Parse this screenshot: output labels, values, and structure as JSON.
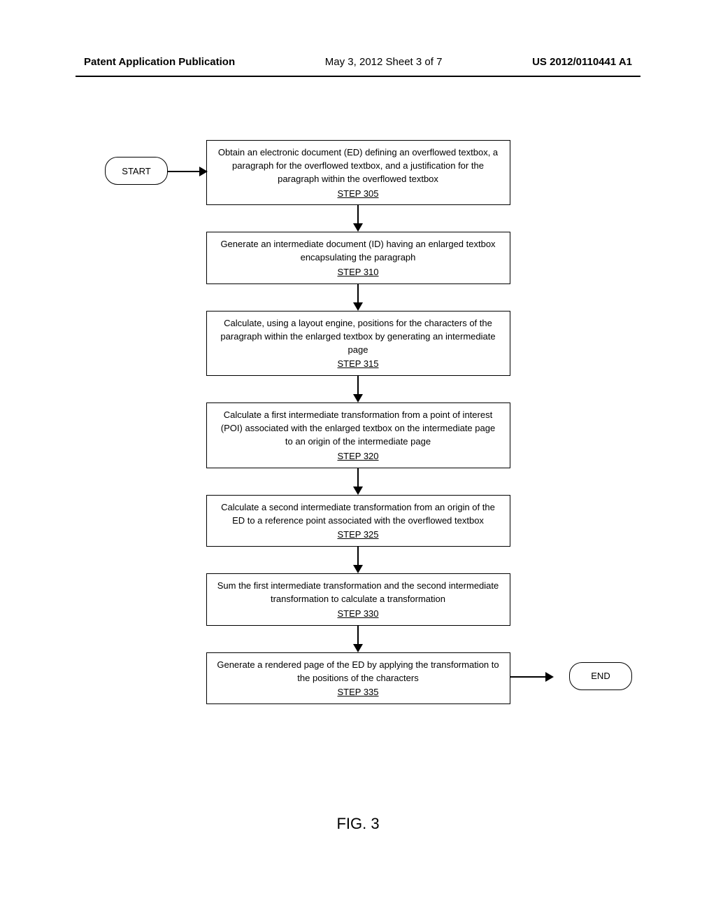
{
  "header": {
    "left": "Patent Application Publication",
    "center": "May 3, 2012   Sheet 3 of 7",
    "right": "US 2012/0110441 A1"
  },
  "terminals": {
    "start": "START",
    "end": "END"
  },
  "steps": [
    {
      "text": "Obtain an electronic document (ED) defining an overflowed textbox, a paragraph for the overflowed textbox, and a justification for the paragraph within the overflowed textbox",
      "label": "STEP 305"
    },
    {
      "text": "Generate an intermediate document (ID) having an enlarged textbox encapsulating the paragraph",
      "label": "STEP 310"
    },
    {
      "text": "Calculate, using a layout engine, positions for the characters of the paragraph within the enlarged textbox by generating an intermediate page",
      "label": "STEP 315"
    },
    {
      "text": "Calculate a first intermediate transformation from a point of interest (POI) associated with the enlarged textbox on the intermediate page to an origin of the intermediate page",
      "label": "STEP 320"
    },
    {
      "text": "Calculate a second intermediate transformation from an origin of the ED to a reference point associated with the overflowed textbox",
      "label": "STEP 325"
    },
    {
      "text": "Sum the first intermediate transformation and the second intermediate transformation to calculate a transformation",
      "label": "STEP 330"
    },
    {
      "text": "Generate a rendered page of the ED by applying the transformation to the positions of the characters",
      "label": "STEP 335"
    }
  ],
  "figureLabel": "FIG. 3",
  "chart_data": {
    "type": "flowchart",
    "title": "FIG. 3",
    "nodes": [
      {
        "id": "start",
        "kind": "terminal",
        "label": "START"
      },
      {
        "id": "s305",
        "kind": "process",
        "label": "STEP 305",
        "text": "Obtain an electronic document (ED) defining an overflowed textbox, a paragraph for the overflowed textbox, and a justification for the paragraph within the overflowed textbox"
      },
      {
        "id": "s310",
        "kind": "process",
        "label": "STEP 310",
        "text": "Generate an intermediate document (ID) having an enlarged textbox encapsulating the paragraph"
      },
      {
        "id": "s315",
        "kind": "process",
        "label": "STEP 315",
        "text": "Calculate, using a layout engine, positions for the characters of the paragraph within the enlarged textbox by generating an intermediate page"
      },
      {
        "id": "s320",
        "kind": "process",
        "label": "STEP 320",
        "text": "Calculate a first intermediate transformation from a point of interest (POI) associated with the enlarged textbox on the intermediate page to an origin of the intermediate page"
      },
      {
        "id": "s325",
        "kind": "process",
        "label": "STEP 325",
        "text": "Calculate a second intermediate transformation from an origin of the ED to a reference point associated with the overflowed textbox"
      },
      {
        "id": "s330",
        "kind": "process",
        "label": "STEP 330",
        "text": "Sum the first intermediate transformation and the second intermediate transformation to calculate a transformation"
      },
      {
        "id": "s335",
        "kind": "process",
        "label": "STEP 335",
        "text": "Generate a rendered page of the ED by applying the transformation to the positions of the characters"
      },
      {
        "id": "end",
        "kind": "terminal",
        "label": "END"
      }
    ],
    "edges": [
      [
        "start",
        "s305"
      ],
      [
        "s305",
        "s310"
      ],
      [
        "s310",
        "s315"
      ],
      [
        "s315",
        "s320"
      ],
      [
        "s320",
        "s325"
      ],
      [
        "s325",
        "s330"
      ],
      [
        "s330",
        "s335"
      ],
      [
        "s335",
        "end"
      ]
    ]
  }
}
